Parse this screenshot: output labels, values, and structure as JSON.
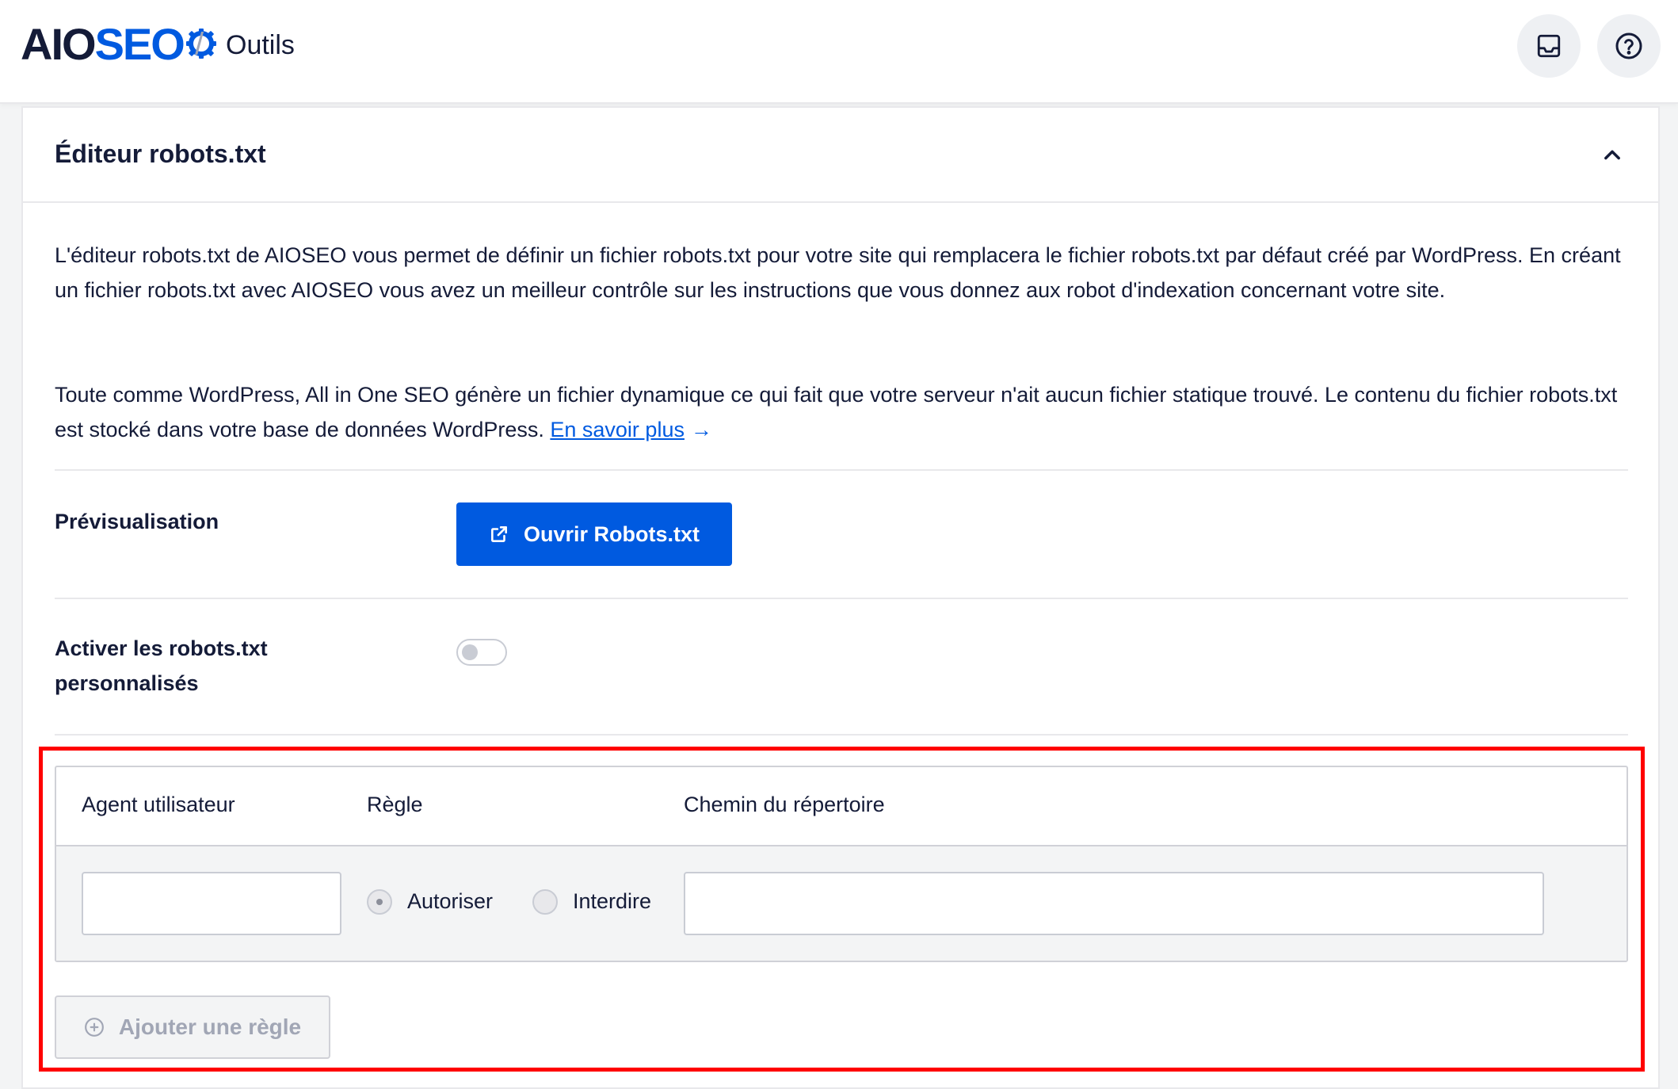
{
  "header": {
    "logo_part1": "AIO",
    "logo_part2": "SEO",
    "separator": "/",
    "breadcrumb": "Outils",
    "brand_color": "#005ae0",
    "icons": [
      "inbox-icon",
      "help-icon"
    ]
  },
  "card": {
    "title": "Éditeur robots.txt",
    "paragraph1": "L'éditeur robots.txt de AIOSEO vous permet de définir un fichier robots.txt pour votre site qui remplacera le fichier robots.txt par défaut créé par WordPress. En créant un fichier robots.txt avec AIOSEO vous avez un meilleur contrôle sur les instructions que vous donnez aux robot d'indexation concernant votre site.",
    "paragraph2": "Toute comme WordPress, All in One SEO génère un fichier dynamique ce qui fait que votre serveur n'ait aucun fichier statique trouvé. Le contenu du fichier robots.txt est stocké dans votre base de données WordPress.",
    "learn_more": "En savoir plus",
    "learn_more_arrow": "→"
  },
  "preview": {
    "label": "Prévisualisation",
    "button_label": "Ouvrir Robots.txt"
  },
  "custom_robots": {
    "label_line1": "Activer les robots.txt",
    "label_line2": "personnalisés",
    "enabled": false
  },
  "rules_table": {
    "columns": [
      "Agent utilisateur",
      "Règle",
      "Chemin du répertoire"
    ],
    "row": {
      "user_agent": "",
      "rule_options": [
        "Autoriser",
        "Interdire"
      ],
      "selected_rule": "Autoriser",
      "directory_path": ""
    },
    "add_button": "Ajouter une règle"
  },
  "highlight_color": "#ff0000"
}
